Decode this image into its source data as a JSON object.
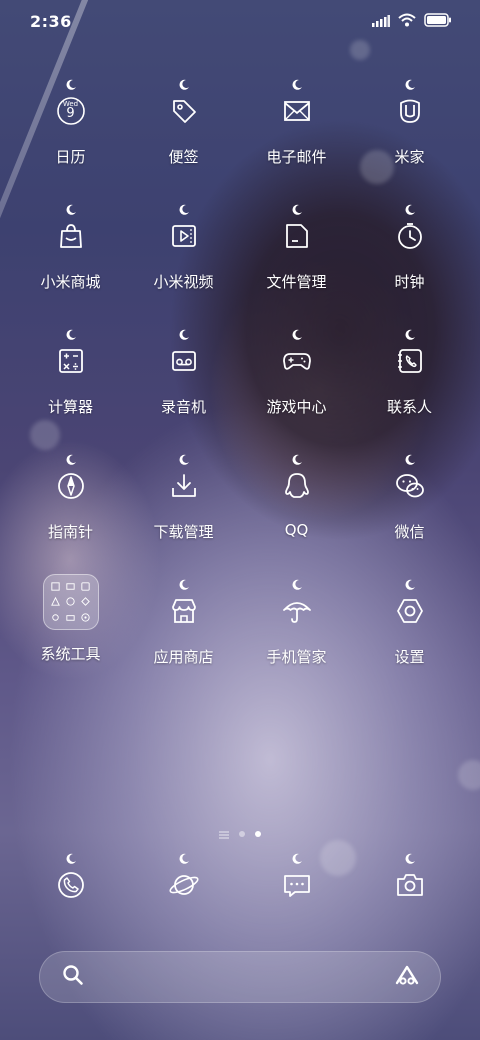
{
  "status_bar": {
    "time": "2:36",
    "icons": [
      "signal-icon",
      "wifi-icon",
      "battery-icon"
    ]
  },
  "calendar_icon": {
    "weekday": "Wed",
    "date": "9"
  },
  "apps": [
    {
      "label": "日历",
      "icon": "calendar-icon"
    },
    {
      "label": "便签",
      "icon": "tag-icon"
    },
    {
      "label": "电子邮件",
      "icon": "mail-icon"
    },
    {
      "label": "米家",
      "icon": "mijia-icon"
    },
    {
      "label": "小米商城",
      "icon": "shopping-bag-icon"
    },
    {
      "label": "小米视频",
      "icon": "video-icon"
    },
    {
      "label": "文件管理",
      "icon": "file-icon"
    },
    {
      "label": "时钟",
      "icon": "clock-icon"
    },
    {
      "label": "计算器",
      "icon": "calculator-icon"
    },
    {
      "label": "录音机",
      "icon": "recorder-icon"
    },
    {
      "label": "游戏中心",
      "icon": "gamepad-icon"
    },
    {
      "label": "联系人",
      "icon": "contacts-icon"
    },
    {
      "label": "指南针",
      "icon": "compass-icon"
    },
    {
      "label": "下载管理",
      "icon": "download-icon"
    },
    {
      "label": "QQ",
      "icon": "qq-icon"
    },
    {
      "label": "微信",
      "icon": "wechat-icon"
    },
    {
      "label": "系统工具",
      "icon": "folder-icon"
    },
    {
      "label": "应用商店",
      "icon": "store-icon"
    },
    {
      "label": "手机管家",
      "icon": "umbrella-icon"
    },
    {
      "label": "设置",
      "icon": "settings-icon"
    }
  ],
  "pager": {
    "pages": 2,
    "current": 2
  },
  "dock": [
    {
      "icon": "phone-icon"
    },
    {
      "icon": "planet-icon"
    },
    {
      "icon": "message-icon"
    },
    {
      "icon": "camera-icon"
    }
  ],
  "search": {
    "left_icon": "search-icon",
    "right_icon": "assistant-icon"
  }
}
